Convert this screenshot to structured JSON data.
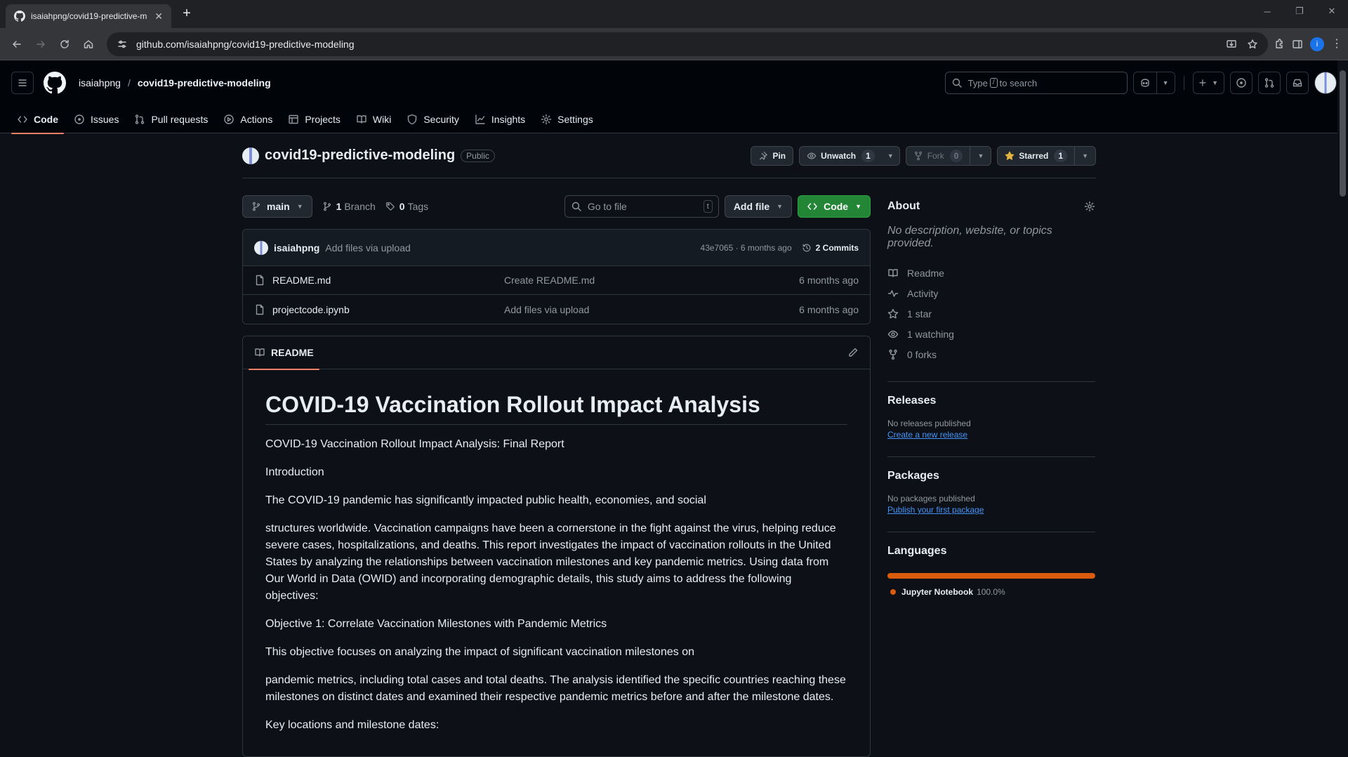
{
  "browser": {
    "tab_title": "isaiahpng/covid19-predictive-m",
    "url": "github.com/isaiahpng/covid19-predictive-modeling",
    "profile_initial": "i"
  },
  "header": {
    "owner": "isaiahpng",
    "separator": "/",
    "repo": "covid19-predictive-modeling",
    "search_prefix": "Type",
    "search_key": "/",
    "search_suffix": "to search"
  },
  "repo_nav": [
    {
      "label": "Code",
      "icon": "code-icon"
    },
    {
      "label": "Issues",
      "icon": "issue-icon"
    },
    {
      "label": "Pull requests",
      "icon": "pull-request-icon"
    },
    {
      "label": "Actions",
      "icon": "play-icon"
    },
    {
      "label": "Projects",
      "icon": "table-icon"
    },
    {
      "label": "Wiki",
      "icon": "book-icon"
    },
    {
      "label": "Security",
      "icon": "shield-icon"
    },
    {
      "label": "Insights",
      "icon": "graph-icon"
    },
    {
      "label": "Settings",
      "icon": "gear-icon"
    }
  ],
  "repo": {
    "name": "covid19-predictive-modeling",
    "visibility": "Public",
    "pin_label": "Pin",
    "unwatch_label": "Unwatch",
    "watch_count": "1",
    "fork_label": "Fork",
    "fork_count": "0",
    "star_label": "Starred",
    "star_count": "1"
  },
  "filenav": {
    "branch": "main",
    "branch_count": "1",
    "branch_label": "Branch",
    "tag_count": "0",
    "tag_label": "Tags",
    "goto_placeholder": "Go to file",
    "goto_key": "t",
    "add_file_label": "Add file",
    "code_label": "Code"
  },
  "commit": {
    "author": "isaiahpng",
    "message": "Add files via upload",
    "sha_time": "43e7065 · 6 months ago",
    "commits_label": "2 Commits"
  },
  "files": [
    {
      "name": "README.md",
      "message": "Create README.md",
      "date": "6 months ago"
    },
    {
      "name": "projectcode.ipynb",
      "message": "Add files via upload",
      "date": "6 months ago"
    }
  ],
  "readme": {
    "tab_label": "README",
    "title": "COVID-19 Vaccination Rollout Impact Analysis",
    "paragraphs": [
      "COVID-19 Vaccination Rollout Impact Analysis: Final Report",
      "Introduction",
      "The COVID-19 pandemic has significantly impacted public health, economies, and social",
      "structures worldwide. Vaccination campaigns have been a cornerstone in the fight against the virus, helping reduce severe cases, hospitalizations, and deaths. This report investigates the impact of vaccination rollouts in the United States by analyzing the relationships between vaccination milestones and key pandemic metrics. Using data from Our World in Data (OWID) and incorporating demographic details, this study aims to address the following objectives:",
      "Objective 1: Correlate Vaccination Milestones with Pandemic Metrics",
      "This objective focuses on analyzing the impact of significant vaccination milestones on",
      "pandemic metrics, including total cases and total deaths. The analysis identified the specific countries reaching these milestones on distinct dates and examined their respective pandemic metrics before and after the milestone dates.",
      "Key locations and milestone dates:"
    ]
  },
  "about": {
    "title": "About",
    "description": "No description, website, or topics provided.",
    "stats": [
      {
        "label": "Readme",
        "icon": "book-icon"
      },
      {
        "label": "Activity",
        "icon": "pulse-icon"
      },
      {
        "label": "1 star",
        "icon": "star-icon"
      },
      {
        "label": "1 watching",
        "icon": "eye-icon"
      },
      {
        "label": "0 forks",
        "icon": "fork-icon"
      }
    ]
  },
  "releases": {
    "title": "Releases",
    "note": "No releases published",
    "link": "Create a new release"
  },
  "packages": {
    "title": "Packages",
    "note": "No packages published",
    "link": "Publish your first package"
  },
  "languages": {
    "title": "Languages",
    "name": "Jupyter Notebook",
    "percent": "100.0%",
    "color": "#da5b0b",
    "share": 1.0
  },
  "colors": {
    "accent_underline": "#f78166",
    "code_button": "#238636",
    "link": "#4493f8",
    "star": "#e3b341"
  }
}
